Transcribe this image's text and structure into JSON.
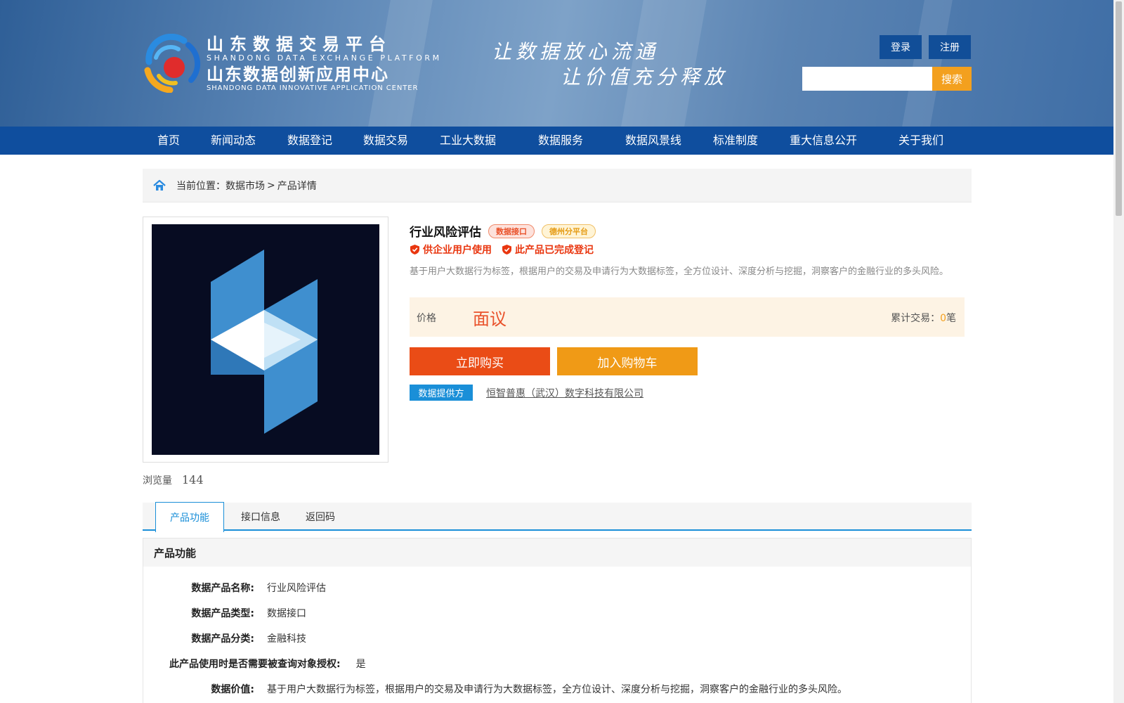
{
  "header": {
    "brand_cn_1": "山东数据交易平台",
    "brand_en_1": "SHANDONG DATA EXCHANGE PLATFORM",
    "brand_cn_2": "山东数据创新应用中心",
    "brand_en_2": "SHANDONG DATA INNOVATIVE APPLICATION CENTER",
    "slogan_1": "让数据放心流通",
    "slogan_2": "让价值充分释放",
    "login_label": "登录",
    "register_label": "注册",
    "search_placeholder": "",
    "search_label": "搜索"
  },
  "nav": {
    "items": [
      "首页",
      "新闻动态",
      "数据登记",
      "数据交易",
      "工业大数据",
      "数据服务",
      "数据风景线",
      "标准制度",
      "重大信息公开",
      "关于我们"
    ]
  },
  "breadcrumb": {
    "prefix": "当前位置：",
    "level1": "数据市场",
    "sep": ">",
    "level2": "产品详情"
  },
  "product": {
    "title": "行业风险评估",
    "tag_type": "数据接口",
    "tag_platform": "德州分平台",
    "badge_enterprise": "供企业用户使用",
    "badge_registered": "此产品已完成登记",
    "description": "基于用户大数据行为标签，根据用户的交易及申请行为大数据标签，全方位设计、深度分析与挖掘，洞察客户的金融行业的多头风险。",
    "price_label": "价格",
    "price_value": "面议",
    "total_label": "累计交易：",
    "total_count": "0",
    "total_unit": "笔",
    "buy_label": "立即购买",
    "cart_label": "加入购物车",
    "provider_label": "数据提供方",
    "provider_name": "恒智普惠（武汉）数字科技有限公司",
    "views_label": "浏览量",
    "views_count": "144"
  },
  "tabs": [
    "产品功能",
    "接口信息",
    "返回码"
  ],
  "section": {
    "title": "产品功能",
    "rows": [
      {
        "key": "数据产品名称:",
        "value": "行业风险评估"
      },
      {
        "key": "数据产品类型:",
        "value": "数据接口"
      },
      {
        "key": "数据产品分类:",
        "value": "金融科技"
      },
      {
        "key": "此产品使用时是否需要被查询对象授权:",
        "value": "是"
      },
      {
        "key": "数据价值:",
        "value": "基于用户大数据行为标签，根据用户的交易及申请行为大数据标签，全方位设计、深度分析与挖掘，洞察客户的金融行业的多头风险。"
      }
    ]
  },
  "colors": {
    "nav_bg": "#0f4e9e",
    "accent_blue": "#1a8fd8",
    "buy": "#ea4c16",
    "cart": "#f09a16",
    "price": "#e9512a"
  }
}
